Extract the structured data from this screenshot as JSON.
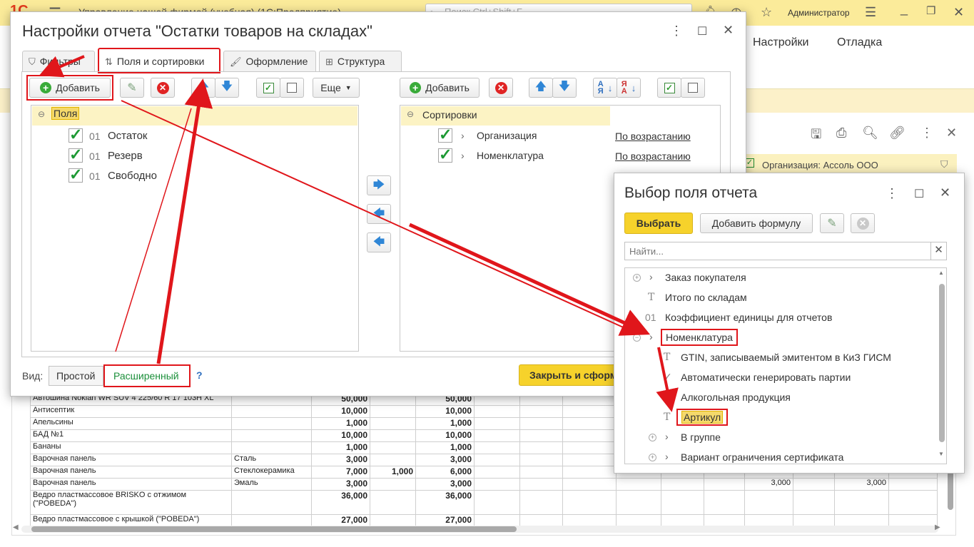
{
  "topbar": {
    "logo": "1С",
    "app_title": "Управление нашей фирмой (учебная)   (1С:Предприятие)",
    "search_placeholder": "Поиск Ctrl+Shift+F",
    "user": "Администратор"
  },
  "app_menu": {
    "settings": "Настройки",
    "debug": "Отладка"
  },
  "report": {
    "org_filter": "Организация: Ассоль ООО",
    "rows": [
      {
        "name": "Автошина Nokian WR SUV 4 225/60 R 17 103H XL",
        "char": "",
        "a": "50,000",
        "b": "",
        "c": "50,000"
      },
      {
        "name": "Антисептик",
        "char": "",
        "a": "10,000",
        "b": "",
        "c": "10,000"
      },
      {
        "name": "Апельсины",
        "char": "",
        "a": "1,000",
        "b": "",
        "c": "1,000"
      },
      {
        "name": "БАД №1",
        "char": "",
        "a": "10,000",
        "b": "",
        "c": "10,000"
      },
      {
        "name": "Бананы",
        "char": "",
        "a": "1,000",
        "b": "",
        "c": "1,000"
      },
      {
        "name": "Варочная панель",
        "char": "Сталь",
        "a": "3,000",
        "b": "",
        "c": "3,000"
      },
      {
        "name": "Варочная панель",
        "char": "Стеклокерамика",
        "a": "7,000",
        "b": "1,000",
        "c": "6,000"
      },
      {
        "name": "Варочная панель",
        "char": "Эмаль",
        "a": "3,000",
        "b": "",
        "c": "3,000",
        "x1": "3,000",
        "x2": "3,000"
      },
      {
        "name": "Ведро пластмассовое BRISKO с отжимом (\"POBEDA\")",
        "char": "",
        "a": "36,000",
        "b": "",
        "c": "36,000"
      },
      {
        "name": "Ведро пластмассовое с крышкой (\"POBEDA\")",
        "char": "",
        "a": "27,000",
        "b": "",
        "c": "27,000"
      }
    ]
  },
  "settings_dialog": {
    "title": "Настройки отчета \"Остатки товаров на складах\"",
    "tabs": [
      "Фильтры",
      "Поля и сортировки",
      "Оформление",
      "Структура"
    ],
    "left": {
      "add_label": "Добавить",
      "more_label": "Еще",
      "header": "Поля",
      "rows": [
        {
          "prefix": "01",
          "label": "Остаток"
        },
        {
          "prefix": "01",
          "label": "Резерв"
        },
        {
          "prefix": "01",
          "label": "Свободно"
        }
      ]
    },
    "right": {
      "add_label": "Добавить",
      "header": "Сортировки",
      "rows": [
        {
          "label": "Организация",
          "order": "По возрастанию"
        },
        {
          "label": "Номенклатура",
          "order": "По возрастанию"
        }
      ]
    },
    "footer": {
      "view_label": "Вид:",
      "simple": "Простой",
      "extended": "Расширенный",
      "help": "?",
      "close_button": "Закрыть и сформировать"
    }
  },
  "pick_dialog": {
    "title": "Выбор поля отчета",
    "select_label": "Выбрать",
    "add_formula_label": "Добавить формулу",
    "search_placeholder": "Найти...",
    "items": [
      {
        "type": "plus",
        "label": "Заказ покупателя"
      },
      {
        "type": "T",
        "label": "Итого по складам"
      },
      {
        "type": "01",
        "label": "Коэффициент единицы для отчетов"
      },
      {
        "type": "minus",
        "label": "Номенклатура"
      },
      {
        "type": "T",
        "label": "GTIN, записываемый эмитентом в КиЗ ГИСМ"
      },
      {
        "type": "check",
        "label": "Автоматически генерировать партии"
      },
      {
        "type": "check",
        "label": "Алкогольная продукция"
      },
      {
        "type": "T",
        "label": "Артикул"
      },
      {
        "type": "plus",
        "label": "В группе"
      },
      {
        "type": "plus",
        "label": "Вариант ограничения сертификата"
      }
    ]
  },
  "colors": {
    "accent_yellow": "#f6d22b",
    "annotation_red": "#e0161b",
    "check_green": "#1f9a35"
  }
}
